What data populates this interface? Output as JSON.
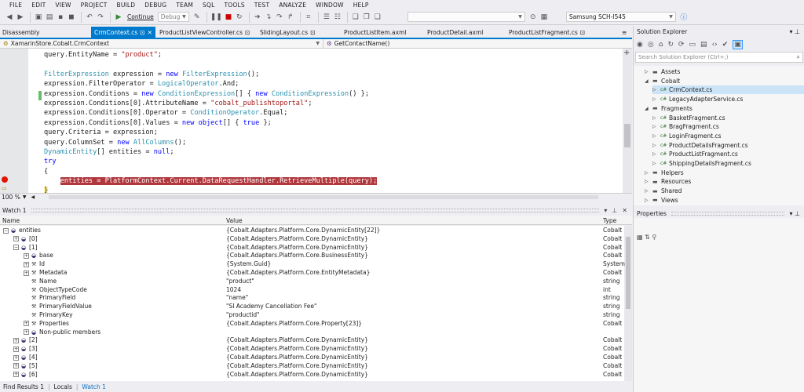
{
  "menu": [
    "FILE",
    "EDIT",
    "VIEW",
    "PROJECT",
    "BUILD",
    "DEBUG",
    "TEAM",
    "SQL",
    "TOOLS",
    "TEST",
    "ANALYZE",
    "WINDOW",
    "HELP"
  ],
  "toolbar": {
    "continue_label": "Continue",
    "config_label": "Debug",
    "device_label": "Samsung SCH-I545"
  },
  "tabs": [
    {
      "label": "Disassembly",
      "active": false
    },
    {
      "label": "CrmContext.cs",
      "active": true
    },
    {
      "label": "ProductListViewController.cs",
      "active": false
    },
    {
      "label": "SlidingLayout.cs",
      "active": false
    },
    {
      "label": "ProductListItem.axml",
      "active": false
    },
    {
      "label": "ProductDetail.axml",
      "active": false
    },
    {
      "label": "ProductListFragment.cs",
      "active": false
    }
  ],
  "navbar": {
    "class_path": "XamarinStore.Cobalt.CrmContext",
    "member": "GetContactName()"
  },
  "code_lines": [
    [
      [
        "",
        "query.EntityName = "
      ],
      [
        "st",
        "\"product\""
      ],
      [
        "",
        ";"
      ]
    ],
    [
      [
        "",
        ""
      ]
    ],
    [
      [
        "ty",
        "FilterExpression"
      ],
      [
        "",
        " expression = "
      ],
      [
        "kw",
        "new"
      ],
      [
        "",
        " "
      ],
      [
        "ty",
        "FilterExpression"
      ],
      [
        "",
        "();"
      ]
    ],
    [
      [
        "",
        "expression.FilterOperator = "
      ],
      [
        "ty",
        "LogicalOperator"
      ],
      [
        "",
        ".And;"
      ]
    ],
    [
      [
        "",
        "expression.Conditions = "
      ],
      [
        "kw",
        "new"
      ],
      [
        "",
        " "
      ],
      [
        "ty",
        "ConditionExpression"
      ],
      [
        "",
        "[] { "
      ],
      [
        "kw",
        "new"
      ],
      [
        "",
        " "
      ],
      [
        "ty",
        "ConditionExpression"
      ],
      [
        "",
        "() };"
      ]
    ],
    [
      [
        "",
        "expression.Conditions[0].AttributeName = "
      ],
      [
        "st",
        "\"cobalt_publishtoportal\""
      ],
      [
        "",
        ";"
      ]
    ],
    [
      [
        "",
        "expression.Conditions[0].Operator = "
      ],
      [
        "ty",
        "ConditionOperator"
      ],
      [
        "",
        ".Equal;"
      ]
    ],
    [
      [
        "",
        "expression.Conditions[0].Values = "
      ],
      [
        "kw",
        "new"
      ],
      [
        "",
        " "
      ],
      [
        "kw",
        "object"
      ],
      [
        "",
        "[] { "
      ],
      [
        "kw",
        "true"
      ],
      [
        "",
        " };"
      ]
    ],
    [
      [
        "",
        "query.Criteria = expression;"
      ]
    ],
    [
      [
        "",
        "query.ColumnSet = "
      ],
      [
        "kw",
        "new"
      ],
      [
        "",
        " "
      ],
      [
        "ty",
        "AllColumns"
      ],
      [
        "",
        "();"
      ]
    ],
    [
      [
        "ty",
        "DynamicEntity"
      ],
      [
        "",
        "[] entities = "
      ],
      [
        "kw",
        "null"
      ],
      [
        "",
        ";"
      ]
    ],
    [
      [
        "kw",
        "try"
      ]
    ],
    [
      [
        "",
        "{"
      ]
    ],
    [
      [
        "",
        "    "
      ],
      [
        "hl",
        "entities = PlatformContext.Current.DataRequestHandler.RetrieveMultiple(query);"
      ]
    ],
    [
      [
        "cur",
        "}"
      ]
    ]
  ],
  "zoom": "100 %",
  "watch": {
    "title": "Watch 1",
    "col_name": "Name",
    "col_value": "Value",
    "col_type": "Type",
    "rows": [
      {
        "indent": 0,
        "exp": "minus",
        "icon": "obj",
        "name": "entities",
        "value": "{Cobalt.Adapters.Platform.Core.DynamicEntity[22]}",
        "type": "Cobalt"
      },
      {
        "indent": 1,
        "exp": "plus",
        "icon": "obj",
        "name": "[0]",
        "value": "{Cobalt.Adapters.Platform.Core.DynamicEntity}",
        "type": "Cobalt"
      },
      {
        "indent": 1,
        "exp": "minus",
        "icon": "obj",
        "name": "[1]",
        "value": "{Cobalt.Adapters.Platform.Core.DynamicEntity}",
        "type": "Cobalt"
      },
      {
        "indent": 2,
        "exp": "plus",
        "icon": "obj",
        "name": "base",
        "value": "{Cobalt.Adapters.Platform.Core.BusinessEntity}",
        "type": "Cobalt"
      },
      {
        "indent": 2,
        "exp": "plus",
        "icon": "prop",
        "name": "Id",
        "value": "{System.Guid}",
        "type": "System"
      },
      {
        "indent": 2,
        "exp": "plus",
        "icon": "prop",
        "name": "Metadata",
        "value": "{Cobalt.Adapters.Platform.Core.EntityMetadata}",
        "type": "Cobalt"
      },
      {
        "indent": 2,
        "exp": "",
        "icon": "prop",
        "name": "Name",
        "value": "\"product\"",
        "type": "string"
      },
      {
        "indent": 2,
        "exp": "",
        "icon": "prop",
        "name": "ObjectTypeCode",
        "value": "1024",
        "type": "int"
      },
      {
        "indent": 2,
        "exp": "",
        "icon": "prop",
        "name": "PrimaryField",
        "value": "\"name\"",
        "type": "string"
      },
      {
        "indent": 2,
        "exp": "",
        "icon": "prop",
        "name": "PrimaryFieldValue",
        "value": "\"SI Academy Cancellation Fee\"",
        "type": "string"
      },
      {
        "indent": 2,
        "exp": "",
        "icon": "prop",
        "name": "PrimaryKey",
        "value": "\"productid\"",
        "type": "string"
      },
      {
        "indent": 2,
        "exp": "plus",
        "icon": "prop",
        "name": "Properties",
        "value": "{Cobalt.Adapters.Platform.Core.Property[23]}",
        "type": "Cobalt"
      },
      {
        "indent": 2,
        "exp": "plus",
        "icon": "obj",
        "name": "Non-public members",
        "value": "",
        "type": ""
      },
      {
        "indent": 1,
        "exp": "plus",
        "icon": "obj",
        "name": "[2]",
        "value": "{Cobalt.Adapters.Platform.Core.DynamicEntity}",
        "type": "Cobalt"
      },
      {
        "indent": 1,
        "exp": "plus",
        "icon": "obj",
        "name": "[3]",
        "value": "{Cobalt.Adapters.Platform.Core.DynamicEntity}",
        "type": "Cobalt"
      },
      {
        "indent": 1,
        "exp": "plus",
        "icon": "obj",
        "name": "[4]",
        "value": "{Cobalt.Adapters.Platform.Core.DynamicEntity}",
        "type": "Cobalt"
      },
      {
        "indent": 1,
        "exp": "plus",
        "icon": "obj",
        "name": "[5]",
        "value": "{Cobalt.Adapters.Platform.Core.DynamicEntity}",
        "type": "Cobalt"
      },
      {
        "indent": 1,
        "exp": "plus",
        "icon": "obj",
        "name": "[6]",
        "value": "{Cobalt.Adapters.Platform.Core.DynamicEntity}",
        "type": "Cobalt"
      }
    ]
  },
  "bottom_tabs": [
    {
      "label": "Find Results 1",
      "active": false
    },
    {
      "label": "Locals",
      "active": false
    },
    {
      "label": "Watch 1",
      "active": true
    }
  ],
  "solution_explorer": {
    "title": "Solution Explorer",
    "search_placeholder": "Search Solution Explorer (Ctrl+;)",
    "items": [
      {
        "level": 1,
        "toggle": "closed",
        "kind": "folder",
        "label": "Assets",
        "selected": false
      },
      {
        "level": 1,
        "toggle": "open",
        "kind": "folder",
        "label": "Cobalt",
        "selected": false
      },
      {
        "level": 2,
        "toggle": "closed",
        "kind": "cs",
        "label": "CrmContext.cs",
        "selected": true
      },
      {
        "level": 2,
        "toggle": "closed",
        "kind": "cs",
        "label": "LegacyAdapterService.cs",
        "selected": false
      },
      {
        "level": 1,
        "toggle": "open",
        "kind": "folder",
        "label": "Fragments",
        "selected": false
      },
      {
        "level": 2,
        "toggle": "closed",
        "kind": "cs",
        "label": "BasketFragment.cs",
        "selected": false
      },
      {
        "level": 2,
        "toggle": "closed",
        "kind": "cs",
        "label": "BragFragment.cs",
        "selected": false
      },
      {
        "level": 2,
        "toggle": "closed",
        "kind": "cs",
        "label": "LoginFragment.cs",
        "selected": false
      },
      {
        "level": 2,
        "toggle": "closed",
        "kind": "cs",
        "label": "ProductDetailsFragment.cs",
        "selected": false
      },
      {
        "level": 2,
        "toggle": "closed",
        "kind": "cs",
        "label": "ProductListFragment.cs",
        "selected": false
      },
      {
        "level": 2,
        "toggle": "closed",
        "kind": "cs",
        "label": "ShippingDetailsFragment.cs",
        "selected": false
      },
      {
        "level": 1,
        "toggle": "closed",
        "kind": "folder",
        "label": "Helpers",
        "selected": false
      },
      {
        "level": 1,
        "toggle": "closed",
        "kind": "folder",
        "label": "Resources",
        "selected": false
      },
      {
        "level": 1,
        "toggle": "closed",
        "kind": "folder",
        "label": "Shared",
        "selected": false
      },
      {
        "level": 1,
        "toggle": "closed",
        "kind": "folder",
        "label": "Views",
        "selected": false
      }
    ]
  },
  "properties": {
    "title": "Properties"
  },
  "colors": {
    "accent": "#007acc",
    "highlight": "#b0383d",
    "keyword": "#0000ff",
    "type": "#2b91af",
    "string": "#a31515"
  }
}
